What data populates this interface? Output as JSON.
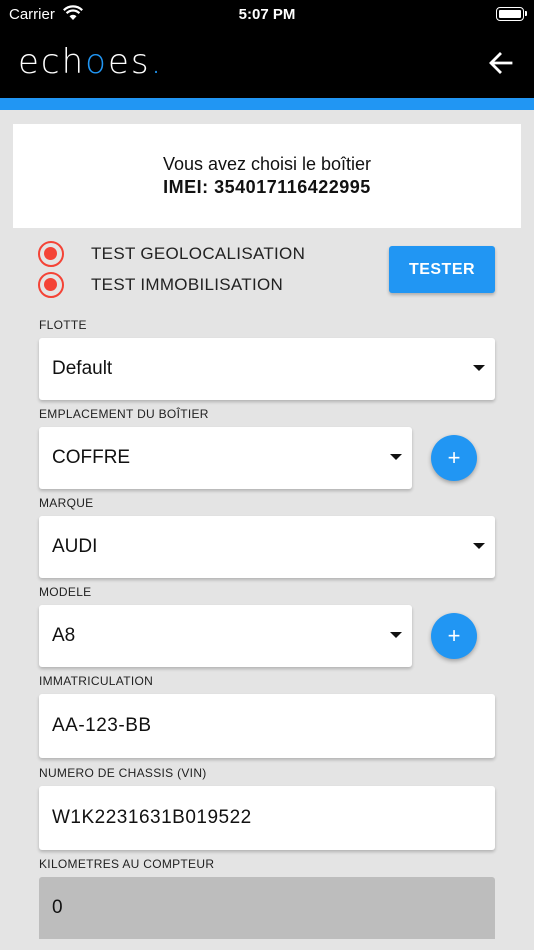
{
  "status_bar": {
    "carrier": "Carrier",
    "time": "5:07 PM"
  },
  "header": {
    "logo_pre": "ech",
    "logo_o": "o",
    "logo_post": "es",
    "logo_dot": ".",
    "back_icon": "arrow-left-icon"
  },
  "colors": {
    "accent": "#2196f3",
    "radio": "#f44336",
    "header_bg": "#000000",
    "page_bg": "#e4e4e4"
  },
  "info": {
    "line1": "Vous avez choisi le boîtier",
    "line2": "IMEI: 354017116422995"
  },
  "tests": [
    {
      "label": "TEST GEOLOCALISATION"
    },
    {
      "label": "TEST IMMOBILISATION"
    }
  ],
  "tester_button": "TESTER",
  "fields": {
    "flotte": {
      "label": "FLOTTE",
      "value": "Default"
    },
    "emplacement": {
      "label": "EMPLACEMENT DU BOÎTIER",
      "value": "COFFRE",
      "add": "+"
    },
    "marque": {
      "label": "MARQUE",
      "value": "AUDI"
    },
    "modele": {
      "label": "MODELE",
      "value": "A8",
      "add": "+"
    },
    "immatriculation": {
      "label": "IMMATRICULATION",
      "value": "AA-123-BB"
    },
    "vin": {
      "label": "NUMERO DE CHASSIS (VIN)",
      "value": "W1K2231631B019522"
    },
    "km": {
      "label": "KILOMETRES AU COMPTEUR",
      "value": "0"
    }
  }
}
